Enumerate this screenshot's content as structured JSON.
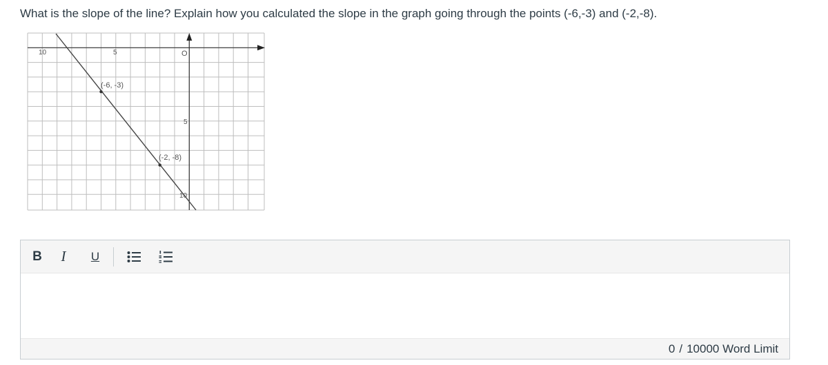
{
  "question": {
    "text": "What is the slope of the line?   Explain how you calculated the slope in the graph going through the points (-6,-3) and (-2,-8)."
  },
  "graph": {
    "labels": {
      "x_left": "10",
      "x_mid": "5",
      "origin": "O",
      "y_mid": "5",
      "y_bottom": "10",
      "point_a": "(-6, -3)",
      "point_b": "(-2, -8)"
    }
  },
  "editor": {
    "toolbar": {
      "bold": "B",
      "italic": "I",
      "underline": "U"
    },
    "status": {
      "count": "0",
      "separator": "/",
      "limit": "10000 Word Limit"
    }
  }
}
